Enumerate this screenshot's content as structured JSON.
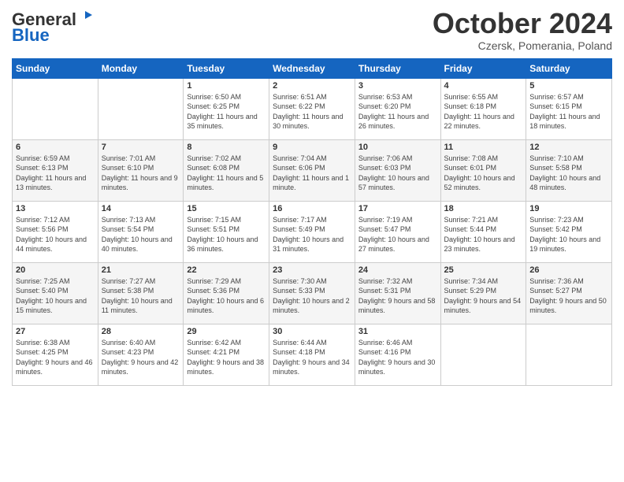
{
  "logo": {
    "general": "General",
    "blue": "Blue"
  },
  "header": {
    "month": "October 2024",
    "location": "Czersk, Pomerania, Poland"
  },
  "weekdays": [
    "Sunday",
    "Monday",
    "Tuesday",
    "Wednesday",
    "Thursday",
    "Friday",
    "Saturday"
  ],
  "weeks": [
    [
      {
        "day": "",
        "sunrise": "",
        "sunset": "",
        "daylight": ""
      },
      {
        "day": "",
        "sunrise": "",
        "sunset": "",
        "daylight": ""
      },
      {
        "day": "1",
        "sunrise": "Sunrise: 6:50 AM",
        "sunset": "Sunset: 6:25 PM",
        "daylight": "Daylight: 11 hours and 35 minutes."
      },
      {
        "day": "2",
        "sunrise": "Sunrise: 6:51 AM",
        "sunset": "Sunset: 6:22 PM",
        "daylight": "Daylight: 11 hours and 30 minutes."
      },
      {
        "day": "3",
        "sunrise": "Sunrise: 6:53 AM",
        "sunset": "Sunset: 6:20 PM",
        "daylight": "Daylight: 11 hours and 26 minutes."
      },
      {
        "day": "4",
        "sunrise": "Sunrise: 6:55 AM",
        "sunset": "Sunset: 6:18 PM",
        "daylight": "Daylight: 11 hours and 22 minutes."
      },
      {
        "day": "5",
        "sunrise": "Sunrise: 6:57 AM",
        "sunset": "Sunset: 6:15 PM",
        "daylight": "Daylight: 11 hours and 18 minutes."
      }
    ],
    [
      {
        "day": "6",
        "sunrise": "Sunrise: 6:59 AM",
        "sunset": "Sunset: 6:13 PM",
        "daylight": "Daylight: 11 hours and 13 minutes."
      },
      {
        "day": "7",
        "sunrise": "Sunrise: 7:01 AM",
        "sunset": "Sunset: 6:10 PM",
        "daylight": "Daylight: 11 hours and 9 minutes."
      },
      {
        "day": "8",
        "sunrise": "Sunrise: 7:02 AM",
        "sunset": "Sunset: 6:08 PM",
        "daylight": "Daylight: 11 hours and 5 minutes."
      },
      {
        "day": "9",
        "sunrise": "Sunrise: 7:04 AM",
        "sunset": "Sunset: 6:06 PM",
        "daylight": "Daylight: 11 hours and 1 minute."
      },
      {
        "day": "10",
        "sunrise": "Sunrise: 7:06 AM",
        "sunset": "Sunset: 6:03 PM",
        "daylight": "Daylight: 10 hours and 57 minutes."
      },
      {
        "day": "11",
        "sunrise": "Sunrise: 7:08 AM",
        "sunset": "Sunset: 6:01 PM",
        "daylight": "Daylight: 10 hours and 52 minutes."
      },
      {
        "day": "12",
        "sunrise": "Sunrise: 7:10 AM",
        "sunset": "Sunset: 5:58 PM",
        "daylight": "Daylight: 10 hours and 48 minutes."
      }
    ],
    [
      {
        "day": "13",
        "sunrise": "Sunrise: 7:12 AM",
        "sunset": "Sunset: 5:56 PM",
        "daylight": "Daylight: 10 hours and 44 minutes."
      },
      {
        "day": "14",
        "sunrise": "Sunrise: 7:13 AM",
        "sunset": "Sunset: 5:54 PM",
        "daylight": "Daylight: 10 hours and 40 minutes."
      },
      {
        "day": "15",
        "sunrise": "Sunrise: 7:15 AM",
        "sunset": "Sunset: 5:51 PM",
        "daylight": "Daylight: 10 hours and 36 minutes."
      },
      {
        "day": "16",
        "sunrise": "Sunrise: 7:17 AM",
        "sunset": "Sunset: 5:49 PM",
        "daylight": "Daylight: 10 hours and 31 minutes."
      },
      {
        "day": "17",
        "sunrise": "Sunrise: 7:19 AM",
        "sunset": "Sunset: 5:47 PM",
        "daylight": "Daylight: 10 hours and 27 minutes."
      },
      {
        "day": "18",
        "sunrise": "Sunrise: 7:21 AM",
        "sunset": "Sunset: 5:44 PM",
        "daylight": "Daylight: 10 hours and 23 minutes."
      },
      {
        "day": "19",
        "sunrise": "Sunrise: 7:23 AM",
        "sunset": "Sunset: 5:42 PM",
        "daylight": "Daylight: 10 hours and 19 minutes."
      }
    ],
    [
      {
        "day": "20",
        "sunrise": "Sunrise: 7:25 AM",
        "sunset": "Sunset: 5:40 PM",
        "daylight": "Daylight: 10 hours and 15 minutes."
      },
      {
        "day": "21",
        "sunrise": "Sunrise: 7:27 AM",
        "sunset": "Sunset: 5:38 PM",
        "daylight": "Daylight: 10 hours and 11 minutes."
      },
      {
        "day": "22",
        "sunrise": "Sunrise: 7:29 AM",
        "sunset": "Sunset: 5:36 PM",
        "daylight": "Daylight: 10 hours and 6 minutes."
      },
      {
        "day": "23",
        "sunrise": "Sunrise: 7:30 AM",
        "sunset": "Sunset: 5:33 PM",
        "daylight": "Daylight: 10 hours and 2 minutes."
      },
      {
        "day": "24",
        "sunrise": "Sunrise: 7:32 AM",
        "sunset": "Sunset: 5:31 PM",
        "daylight": "Daylight: 9 hours and 58 minutes."
      },
      {
        "day": "25",
        "sunrise": "Sunrise: 7:34 AM",
        "sunset": "Sunset: 5:29 PM",
        "daylight": "Daylight: 9 hours and 54 minutes."
      },
      {
        "day": "26",
        "sunrise": "Sunrise: 7:36 AM",
        "sunset": "Sunset: 5:27 PM",
        "daylight": "Daylight: 9 hours and 50 minutes."
      }
    ],
    [
      {
        "day": "27",
        "sunrise": "Sunrise: 6:38 AM",
        "sunset": "Sunset: 4:25 PM",
        "daylight": "Daylight: 9 hours and 46 minutes."
      },
      {
        "day": "28",
        "sunrise": "Sunrise: 6:40 AM",
        "sunset": "Sunset: 4:23 PM",
        "daylight": "Daylight: 9 hours and 42 minutes."
      },
      {
        "day": "29",
        "sunrise": "Sunrise: 6:42 AM",
        "sunset": "Sunset: 4:21 PM",
        "daylight": "Daylight: 9 hours and 38 minutes."
      },
      {
        "day": "30",
        "sunrise": "Sunrise: 6:44 AM",
        "sunset": "Sunset: 4:18 PM",
        "daylight": "Daylight: 9 hours and 34 minutes."
      },
      {
        "day": "31",
        "sunrise": "Sunrise: 6:46 AM",
        "sunset": "Sunset: 4:16 PM",
        "daylight": "Daylight: 9 hours and 30 minutes."
      },
      {
        "day": "",
        "sunrise": "",
        "sunset": "",
        "daylight": ""
      },
      {
        "day": "",
        "sunrise": "",
        "sunset": "",
        "daylight": ""
      }
    ]
  ]
}
